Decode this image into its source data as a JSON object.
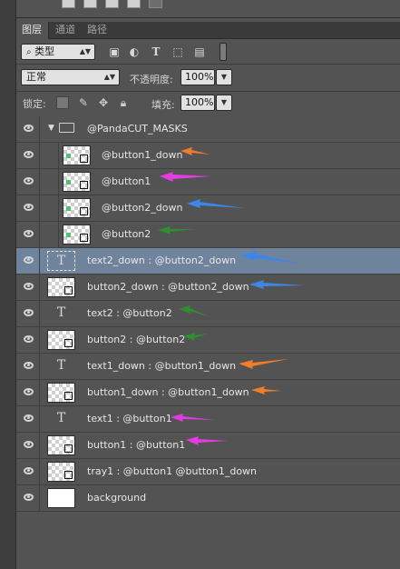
{
  "tabs": [
    "图层",
    "通道",
    "路径"
  ],
  "filter": {
    "kind_label": "类型"
  },
  "blend": {
    "mode": "正常",
    "opacity_label": "不透明度:",
    "opacity_value": "100%"
  },
  "lock": {
    "label": "锁定:",
    "fill_label": "填充:",
    "fill_value": "100%"
  },
  "group": {
    "name": "@PandaCUT_MASKS"
  },
  "layers": [
    {
      "name": "@button1_down"
    },
    {
      "name": "@button1"
    },
    {
      "name": "@button2_down"
    },
    {
      "name": "@button2"
    },
    {
      "name": "text2_down : @button2_down"
    },
    {
      "name": "button2_down : @button2_down"
    },
    {
      "name": "text2 : @button2"
    },
    {
      "name": "button2 : @button2"
    },
    {
      "name": "text1_down : @button1_down"
    },
    {
      "name": "button1_down : @button1_down"
    },
    {
      "name": "text1 : @button1"
    },
    {
      "name": "button1 : @button1"
    },
    {
      "name": "tray1 : @button1 @button1_down"
    },
    {
      "name": "background"
    }
  ],
  "colors": {
    "orange": "#f07d2c",
    "magenta": "#e53be3",
    "blue": "#3d86e6",
    "green": "#2f8f2f",
    "selected_row": "#70839d"
  }
}
